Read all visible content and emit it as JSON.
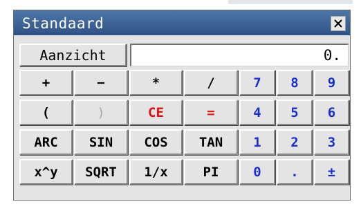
{
  "window": {
    "title": "Standaard"
  },
  "toolbar": {
    "view_label": "Aanzicht"
  },
  "display": {
    "value": "0."
  },
  "colors": {
    "titlebar": "#3a5f94",
    "digit_keys": "#1a2ecc",
    "action_keys": "#e01010",
    "disabled_keys": "#a8a8a8",
    "button_face": "#e4e4e4"
  },
  "keys": {
    "plus": "+",
    "minus": "−",
    "multiply": "*",
    "divide": "/",
    "paren_open": "(",
    "paren_close": ")",
    "clear_entry": "CE",
    "equals": "=",
    "arc": "ARC",
    "sin": "SIN",
    "cos": "COS",
    "tan": "TAN",
    "power": "x^y",
    "sqrt": "SQRT",
    "reciprocal": "1/x",
    "pi": "PI",
    "d7": "7",
    "d8": "8",
    "d9": "9",
    "d4": "4",
    "d5": "5",
    "d6": "6",
    "d1": "1",
    "d2": "2",
    "d3": "3",
    "d0": "0",
    "decimal": ".",
    "sign": "±"
  }
}
